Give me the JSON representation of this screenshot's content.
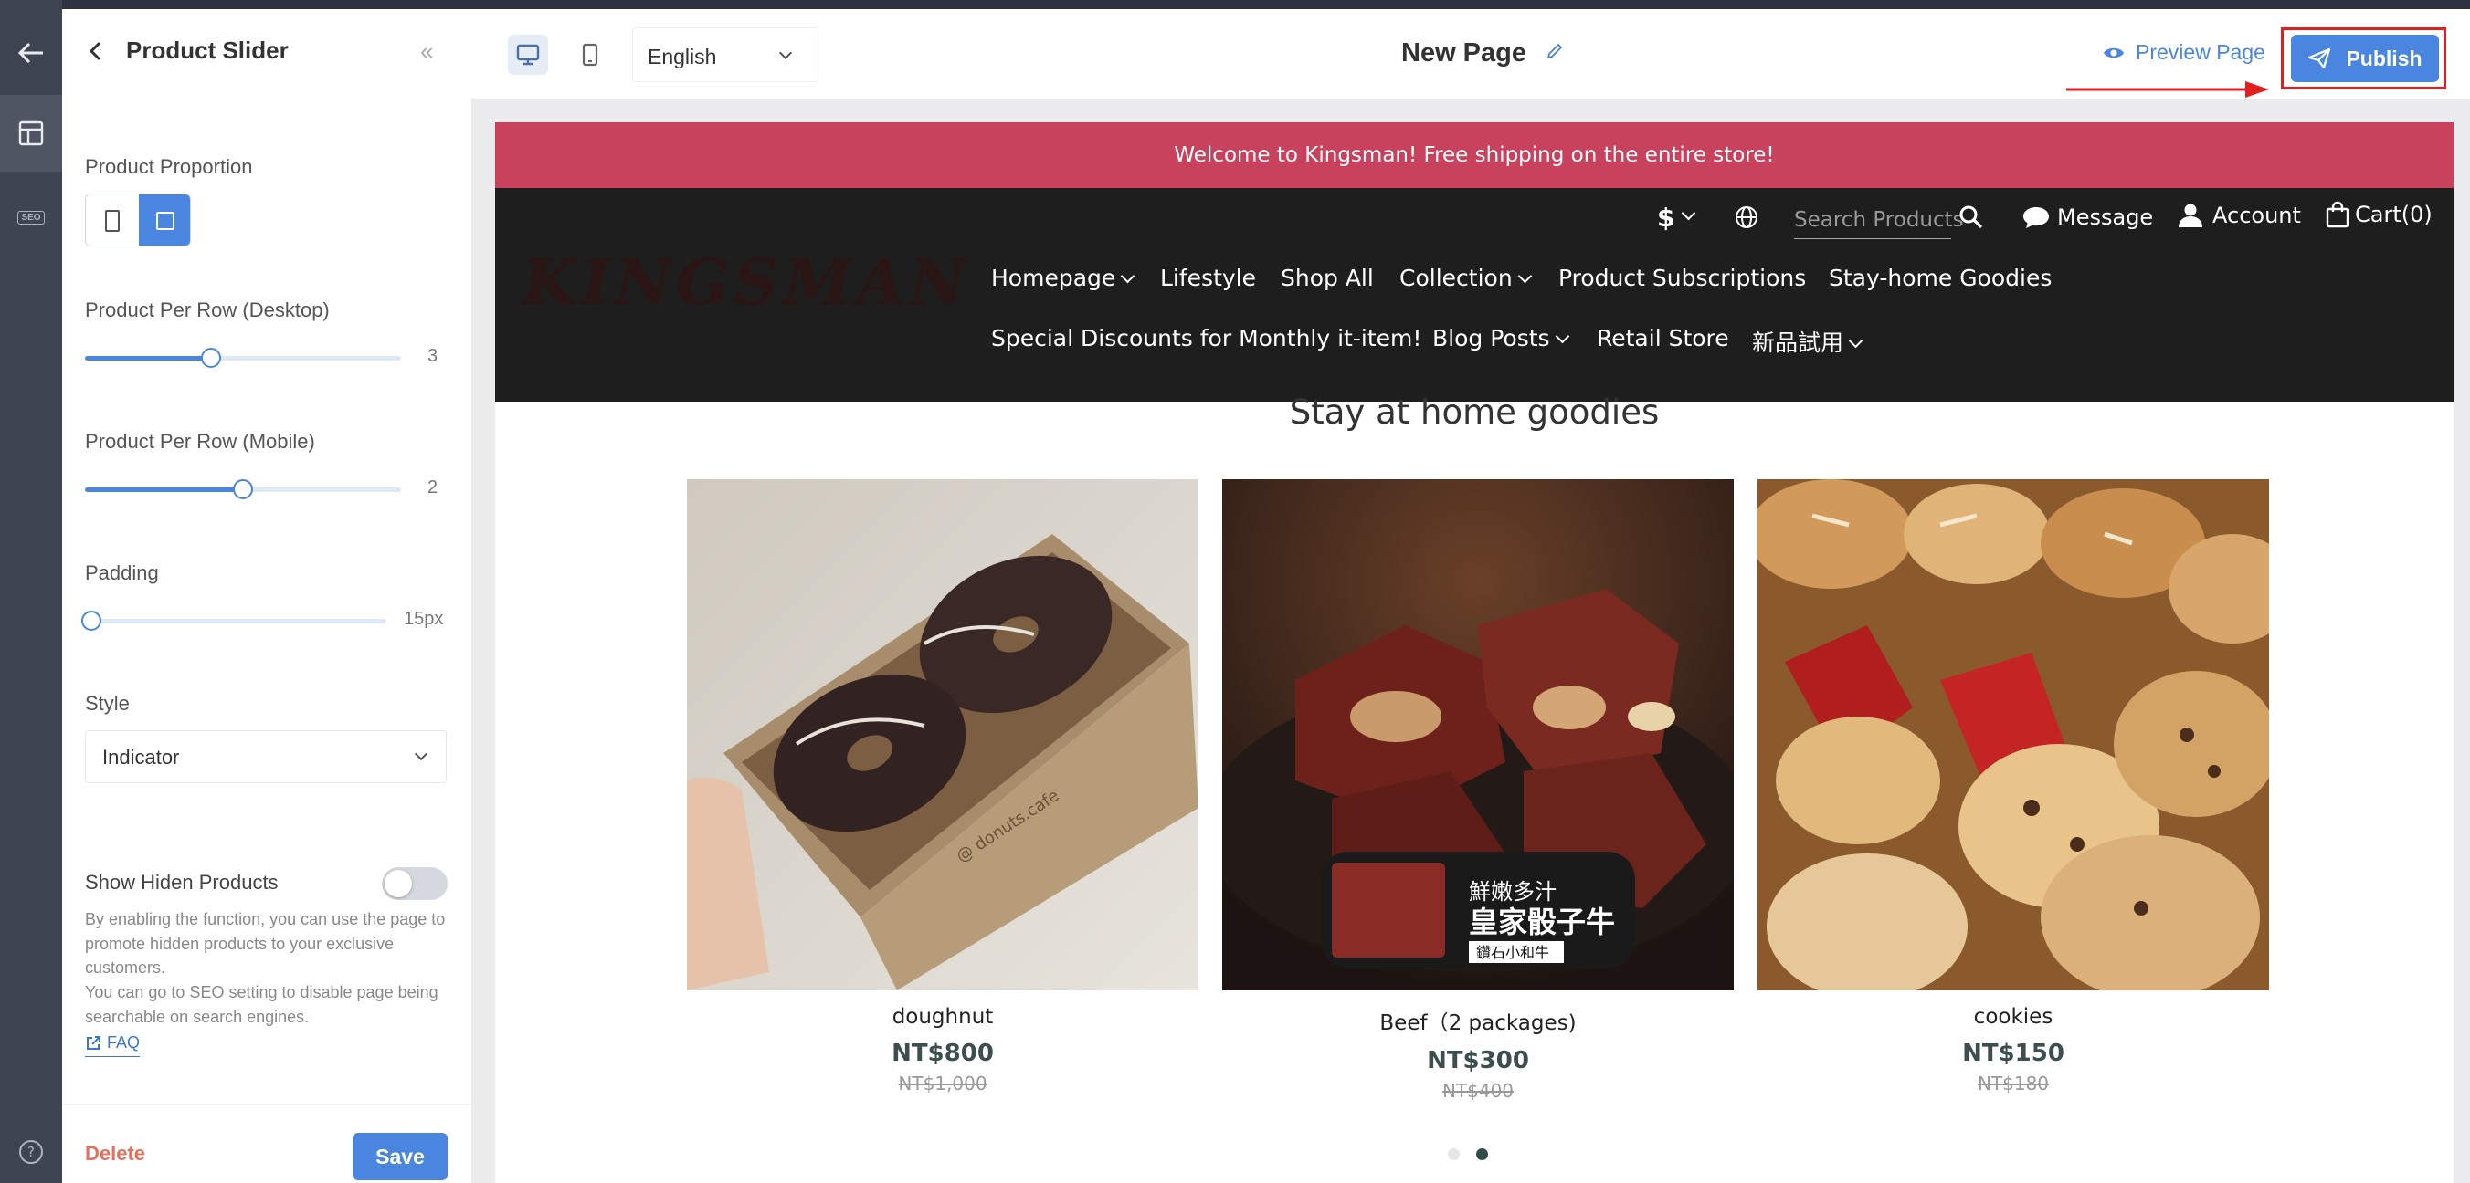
{
  "panel": {
    "title": "Product Slider",
    "proportion_label": "Product Proportion",
    "per_row_desktop_label": "Product Per Row (Desktop)",
    "per_row_desktop_value": "3",
    "per_row_desktop_fraction": 0.4,
    "per_row_mobile_label": "Product Per Row (Mobile)",
    "per_row_mobile_value": "2",
    "per_row_mobile_fraction": 0.5,
    "padding_label": "Padding",
    "padding_value": "15px",
    "padding_fraction": 0.02,
    "style_label": "Style",
    "style_value": "Indicator",
    "hidden_label": "Show Hiden Products",
    "hidden_enabled": false,
    "hidden_desc_1": "By enabling the function, you can use the page to promote hidden products to your exclusive customers.",
    "hidden_desc_2": "You can go to SEO setting to disable page being searchable on search engines.",
    "faq_label": "FAQ",
    "delete_label": "Delete",
    "save_label": "Save"
  },
  "rail": {
    "seo_label": "SEO"
  },
  "toolbar": {
    "language": "English",
    "page_title": "New Page",
    "preview_label": "Preview Page",
    "publish_label": "Publish"
  },
  "store": {
    "announcement": "Welcome to Kingsman! Free shipping on the entire store!",
    "logo": "KINGSMAN",
    "currency": "$",
    "search_placeholder": "Search Products",
    "message_label": "Message",
    "account_label": "Account",
    "cart_label": "Cart(0)",
    "nav_row1": [
      "Homepage",
      "Lifestyle",
      "Shop All",
      "Collection",
      "Product Subscriptions",
      "Stay-home Goodies"
    ],
    "nav_row2": [
      "Special Discounts for Monthly it-item!",
      "Blog Posts",
      "Retail Store",
      "新品試用"
    ],
    "section_title": "Stay at home goodies",
    "beef_overlay_title": "鮮嫩多汁",
    "beef_overlay_main": "皇家骰子牛",
    "beef_overlay_tag": "鑽石小和牛",
    "carousel_total": 2,
    "carousel_active": 2
  },
  "products": [
    {
      "name": "doughnut",
      "price": "NT$800",
      "original": "NT$1,000"
    },
    {
      "name": "Beef（2 packages)",
      "price": "NT$300",
      "original": "NT$400"
    },
    {
      "name": "cookies",
      "price": "NT$150",
      "original": "NT$180"
    }
  ],
  "colors": {
    "accent": "#4a86e0",
    "announcement_bg": "#c8415d",
    "header_bg": "#1e1e1e",
    "price": "#3d4f4d",
    "delete": "#e2715e",
    "highlight": "#e02020"
  }
}
